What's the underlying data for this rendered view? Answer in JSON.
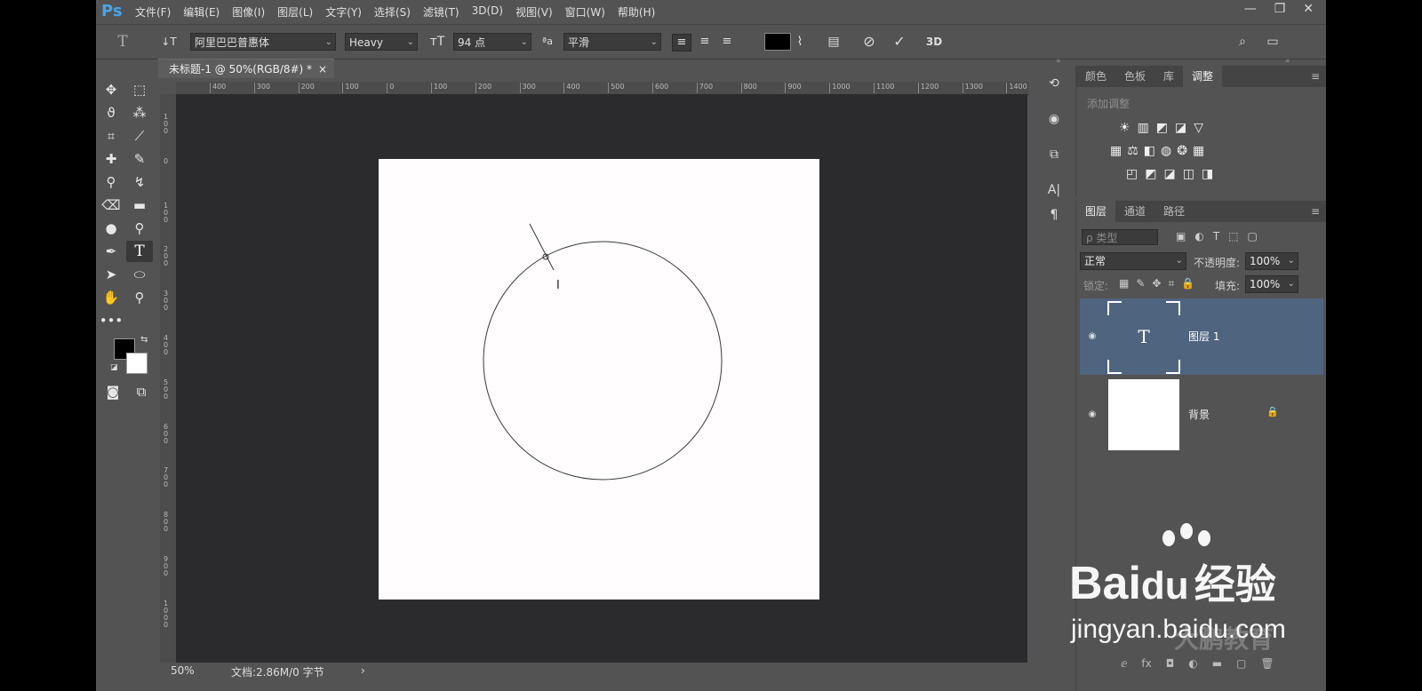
{
  "app": {
    "logo": "Ps"
  },
  "menu": [
    "文件(F)",
    "编辑(E)",
    "图像(I)",
    "图层(L)",
    "文字(Y)",
    "选择(S)",
    "滤镜(T)",
    "3D(D)",
    "视图(V)",
    "窗口(W)",
    "帮助(H)"
  ],
  "window_controls": {
    "minimize": "—",
    "restore": "❐",
    "close": "✕"
  },
  "options": {
    "tool_glyph": "T",
    "orient_glyph": "↓T",
    "font_family": "阿里巴巴普惠体",
    "font_style": "Heavy",
    "size_glyph": "тT",
    "font_size": "94 点",
    "aa_glyph": "ªa",
    "antialias": "平滑",
    "threed": "3D",
    "text_color": "#000000"
  },
  "document": {
    "tab_title": "未标题-1 @ 50%(RGB/8#) *",
    "close": "×",
    "ruler_h": [
      "400",
      "300",
      "200",
      "100",
      "0",
      "100",
      "200",
      "300",
      "400",
      "500",
      "600",
      "700",
      "800",
      "900",
      "1000",
      "1100",
      "1200",
      "1300",
      "1400"
    ],
    "ruler_v": [
      "1\n0\n0",
      "0",
      "1\n0\n0",
      "2\n0\n0",
      "3\n0\n0",
      "4\n0\n0",
      "5\n0\n0",
      "6\n0\n0",
      "7\n0\n0",
      "8\n0\n0",
      "9\n0\n0",
      "1\n0\n0\n0"
    ]
  },
  "status": {
    "zoom": "50%",
    "doc_info": "文档:2.86M/0 字节",
    "arrow": "›"
  },
  "panels_top": {
    "tabs": [
      "颜色",
      "色板",
      "库",
      "调整"
    ],
    "active_tab": "调整",
    "add_adjustment": "添加调整",
    "row1": [
      "☀",
      "▥",
      "◩",
      "◪",
      "▽"
    ],
    "row2": [
      "▦",
      "⚖",
      "◧",
      "◍",
      "❂",
      "▦"
    ],
    "row3": [
      "◰",
      "◩",
      "◪",
      "◫",
      "◨"
    ]
  },
  "layers_panel": {
    "tabs": [
      "图层",
      "通道",
      "路径"
    ],
    "active_tab": "图层",
    "filter_placeholder": "ρ 类型",
    "blend_mode": "正常",
    "opacity_label": "不透明度:",
    "opacity_value": "100%",
    "lock_label": "锁定:",
    "fill_label": "填充:",
    "fill_value": "100%",
    "layers": [
      {
        "name": "图层 1",
        "type_glyph": "T",
        "selected": true
      },
      {
        "name": "背景",
        "locked": true
      }
    ],
    "footer_icons": [
      "ⅇ",
      "fx",
      "◘",
      "◐",
      "▬",
      "▢",
      "🗑"
    ]
  },
  "watermark": {
    "brand_latin": "Bai",
    "brand_du": "du",
    "brand_cn": "经验",
    "url": "jingyan.baidu.com",
    "sub": "大鹏教育"
  }
}
